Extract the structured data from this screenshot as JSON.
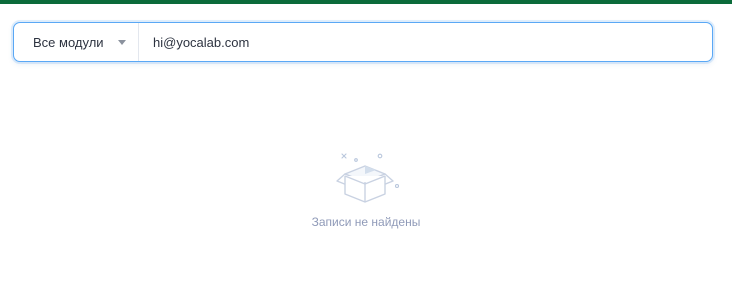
{
  "search": {
    "module_select": {
      "selected": "Все модули",
      "icon": "chevron-down-icon"
    },
    "input_value": "hi@yocalab.com"
  },
  "empty_state": {
    "icon": "empty-box-icon",
    "message": "Записи не найдены"
  },
  "colors": {
    "top_stripe": "#0b6b3a",
    "focus_border": "#5aa8f5",
    "empty_text": "#8f9ab8"
  }
}
